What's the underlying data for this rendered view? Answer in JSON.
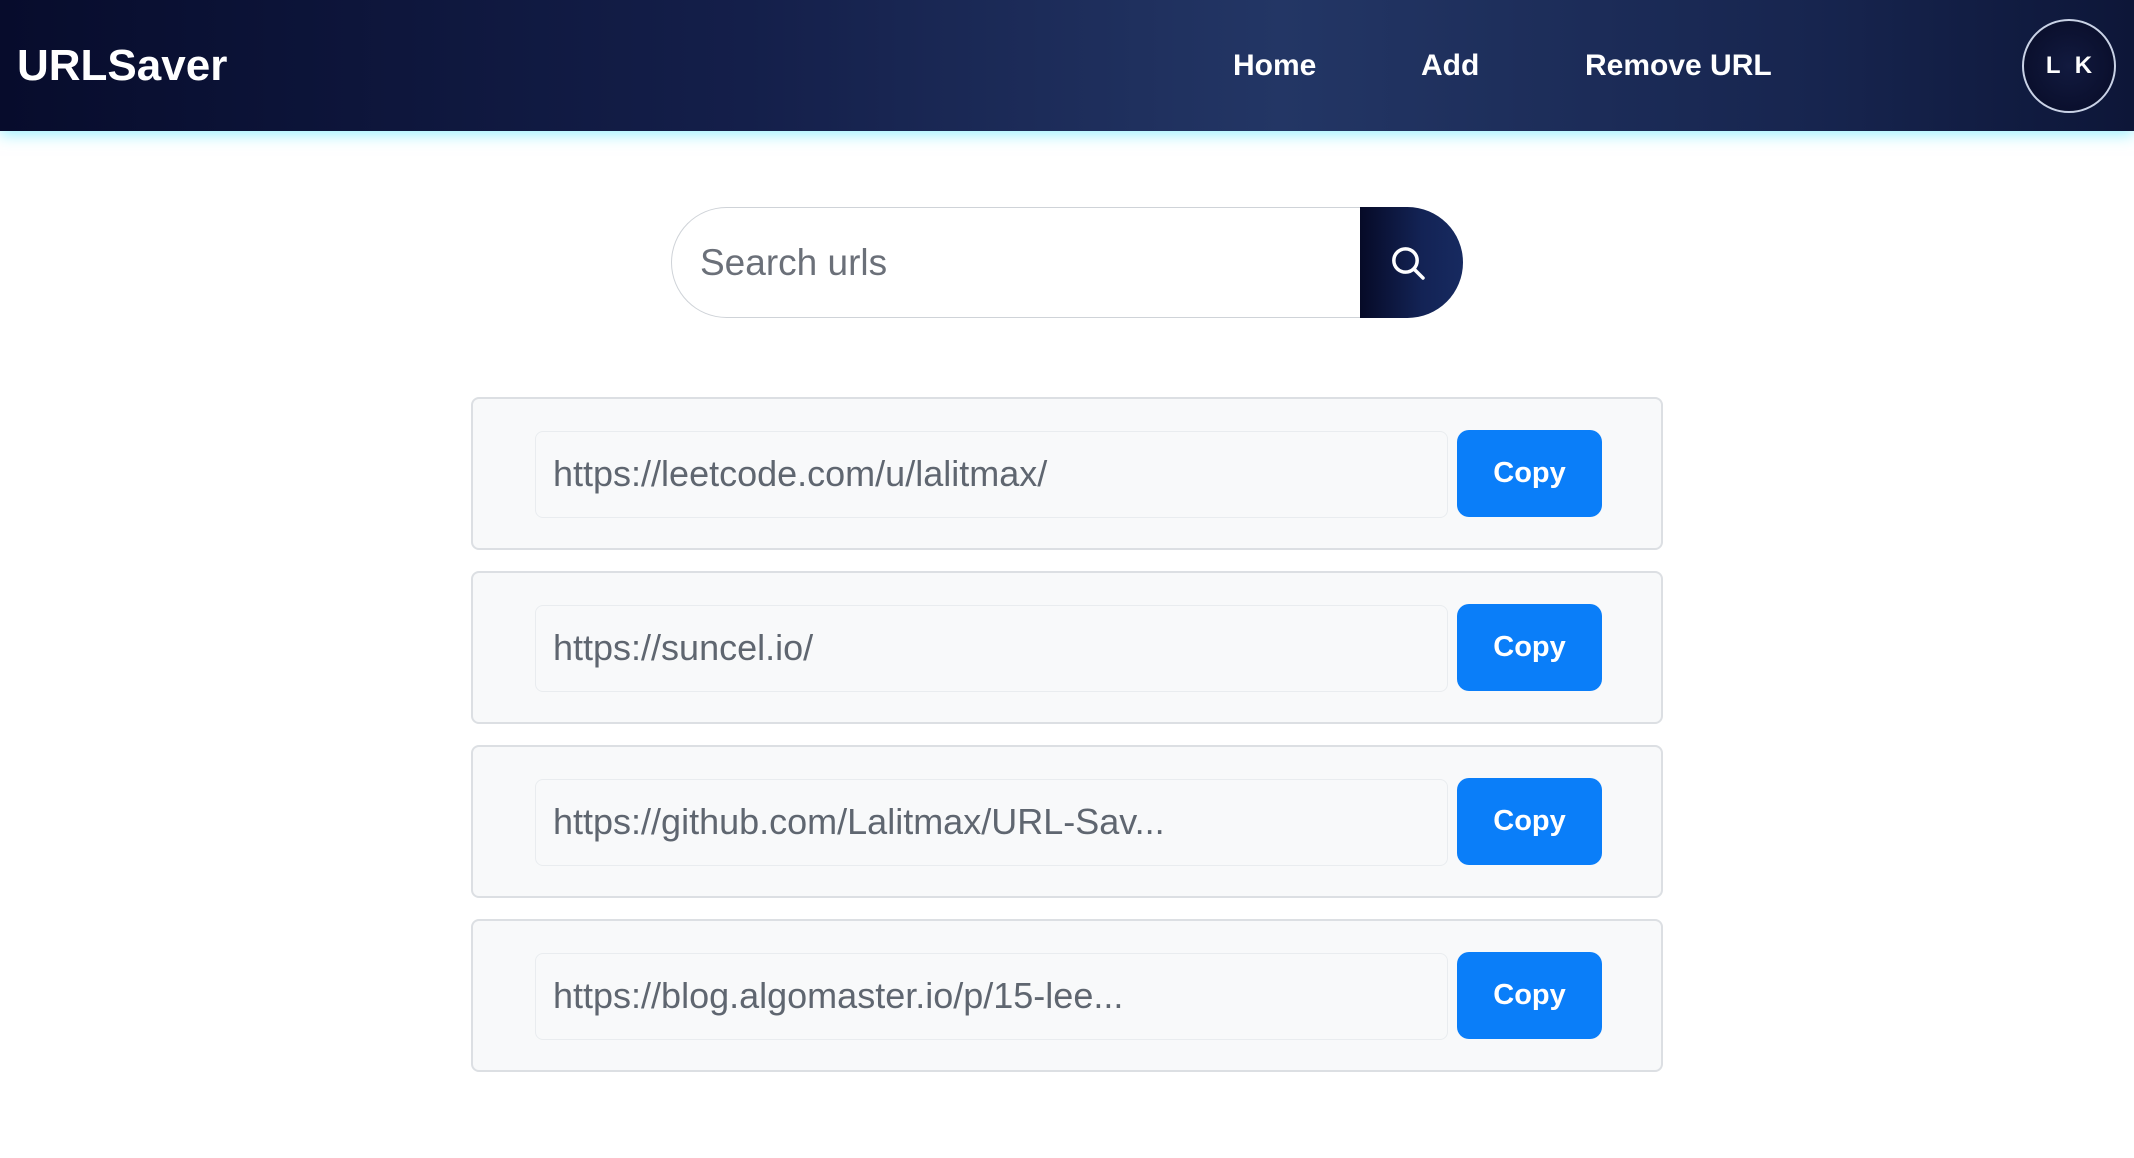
{
  "header": {
    "brand": "URLSaver",
    "nav": [
      {
        "label": "Home"
      },
      {
        "label": "Add"
      },
      {
        "label": "Remove URL"
      }
    ],
    "avatar_initials": "L K"
  },
  "search": {
    "placeholder": "Search urls",
    "value": "",
    "button_icon": "search-icon"
  },
  "urls": [
    {
      "url": "https://leetcode.com/u/lalitmax/",
      "copy_label": "Copy"
    },
    {
      "url": "https://suncel.io/",
      "copy_label": "Copy"
    },
    {
      "url": "https://github.com/Lalitmax/URL-Sav...",
      "copy_label": "Copy"
    },
    {
      "url": "https://blog.algomaster.io/p/15-lee...",
      "copy_label": "Copy"
    }
  ],
  "colors": {
    "header_dark": "#070c2c",
    "header_mid": "#233665",
    "header_glow": "#50e6ff",
    "copy_button": "#0a7ef9",
    "card_bg": "#f8f9fa",
    "card_border": "#dcdfe3"
  }
}
